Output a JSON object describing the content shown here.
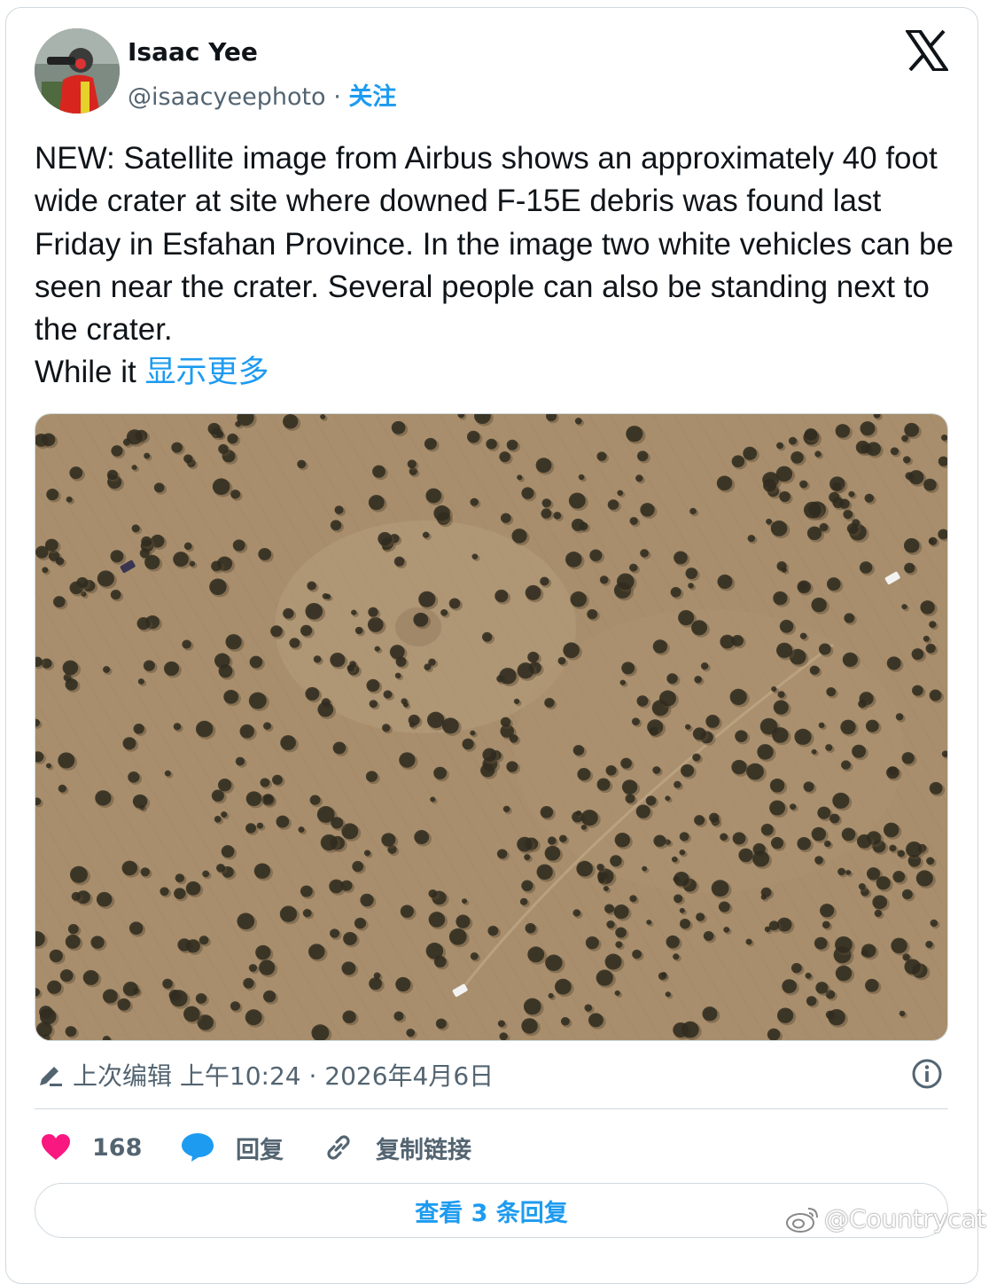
{
  "author": {
    "name": "Isaac Yee",
    "handle": "@isaacyeephoto",
    "separator": "·",
    "follow_label": "关注"
  },
  "platform_logo": "x-logo",
  "tweet": {
    "text": "NEW: Satellite image from Airbus shows an approximately 40 foot wide crater at site where downed F-15E debris was found last Friday in Esfahan Province. In the image two white vehicles can be seen near the crater. Several people can also be standing next to the crater.",
    "truncated_line": "While it ",
    "show_more": "显示更多"
  },
  "media": {
    "kind": "satellite-image",
    "ground_color": "#a88e6c"
  },
  "meta": {
    "edited_label": "上次编辑 上午10:24 · 2026年4月6日"
  },
  "actions": {
    "likes": "168",
    "reply_label": "回复",
    "copy_link_label": "复制链接",
    "like_color": "#f91880",
    "accent_color": "#1d9bf0"
  },
  "replies_button": "查看 3 条回复",
  "watermark": "@Countrycat"
}
